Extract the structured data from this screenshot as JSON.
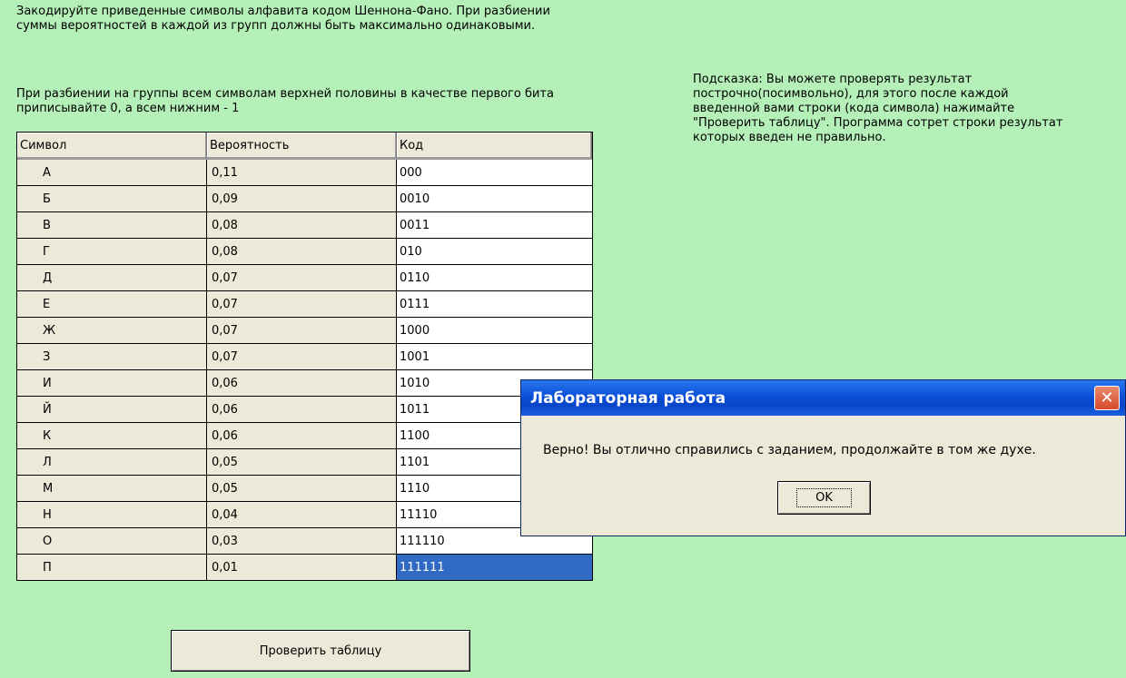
{
  "instructions": {
    "line1": "Закодируйте приведенные символы алфавита кодом Шеннона-Фано. При разбиении суммы вероятностей в каждой из групп должны быть максимально одинаковыми.",
    "line2": "При разбиении на группы всем символам верхней половины в качестве первого бита приписывайте 0, а всем нижним - 1"
  },
  "hint": "Подсказка: Вы можете проверять результат построчно(посимвольно), для этого после каждой введенной вами строки (кода символа) нажимайте \"Проверить таблицу\". Программа сотрет строки результат которых введен не правильно.",
  "table": {
    "headers": [
      "Символ",
      "Вероятность",
      "Код"
    ],
    "rows": [
      [
        "А",
        "0,11",
        "000"
      ],
      [
        "Б",
        "0,09",
        "0010"
      ],
      [
        "В",
        "0,08",
        "0011"
      ],
      [
        "Г",
        "0,08",
        "010"
      ],
      [
        "Д",
        "0,07",
        "0110"
      ],
      [
        "Е",
        "0,07",
        "0111"
      ],
      [
        "Ж",
        "0,07",
        "1000"
      ],
      [
        "З",
        "0,07",
        "1001"
      ],
      [
        "И",
        "0,06",
        "1010"
      ],
      [
        "Й",
        "0,06",
        "1011"
      ],
      [
        "К",
        "0,06",
        "1100"
      ],
      [
        "Л",
        "0,05",
        "1101"
      ],
      [
        "М",
        "0,05",
        "1110"
      ],
      [
        "Н",
        "0,04",
        "11110"
      ],
      [
        "О",
        "0,03",
        "111110"
      ],
      [
        "П",
        "0,01",
        "111111"
      ]
    ],
    "selected_row": 15
  },
  "check_button": "Проверить таблицу",
  "dialog": {
    "title": "Лабораторная работа",
    "message": "Верно! Вы отлично справились с заданием, продолжайте в том же духе.",
    "ok_label": "OK",
    "close_glyph": "✕"
  },
  "colors": {
    "background": "#b5f0b8",
    "title_bar": "#0a4fd8",
    "selection": "#316ac5"
  }
}
